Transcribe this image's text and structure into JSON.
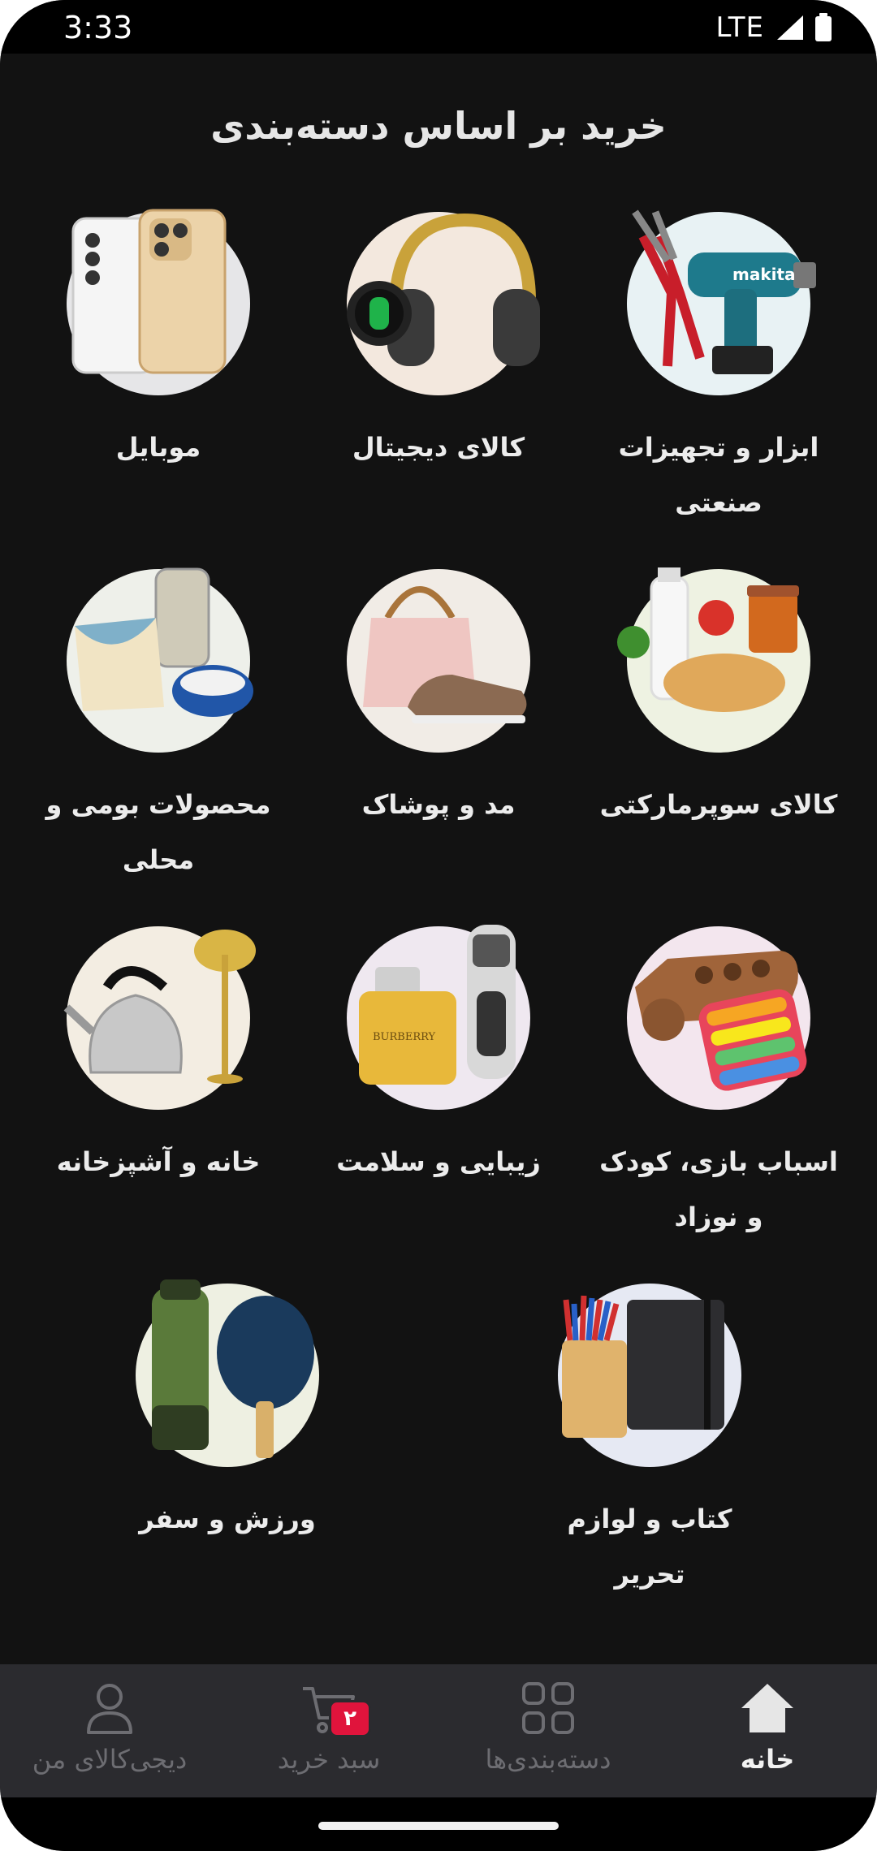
{
  "status_bar": {
    "time": "3:33",
    "network": "LTE"
  },
  "page": {
    "title": "خرید بر اساس دسته‌بندی"
  },
  "categories": [
    {
      "label": "ابزار و تجهیزات صنعتی",
      "icon": "drill-icon",
      "bg": "#e8f2f4"
    },
    {
      "label": "کالای دیجیتال",
      "icon": "headphones-icon",
      "bg": "#f3e8de"
    },
    {
      "label": "موبایل",
      "icon": "smartphone-icon",
      "bg": "#e6e6e8"
    },
    {
      "label": "کالای سوپرمارکتی",
      "icon": "groceries-icon",
      "bg": "#eef2e2"
    },
    {
      "label": "مد و پوشاک",
      "icon": "handbag-icon",
      "bg": "#f1ece6"
    },
    {
      "label": "محصولات بومی و محلی",
      "icon": "local-products-icon",
      "bg": "#eef0ea"
    },
    {
      "label": "اسباب بازی، کودک و نوزاد",
      "icon": "toy-icon",
      "bg": "#f3e6ee"
    },
    {
      "label": "زیبایی و سلامت",
      "icon": "perfume-icon",
      "bg": "#efe8f0"
    },
    {
      "label": "خانه و آشپزخانه",
      "icon": "kettle-icon",
      "bg": "#f3ede2"
    },
    {
      "label": "کتاب و لوازم تحریر",
      "icon": "notebook-icon",
      "bg": "#e6e9f3"
    },
    {
      "label": "ورزش و سفر",
      "icon": "sports-icon",
      "bg": "#eef0e2"
    }
  ],
  "bottom_nav": {
    "items": [
      {
        "label": "خانه",
        "icon": "home-icon",
        "active": true
      },
      {
        "label": "دسته‌بندی‌ها",
        "icon": "categories-icon",
        "active": false
      },
      {
        "label": "سبد خرید",
        "icon": "cart-icon",
        "active": false,
        "badge": "۲"
      },
      {
        "label": "دیجی‌کالای من",
        "icon": "profile-icon",
        "active": false
      }
    ]
  },
  "colors": {
    "background": "#121212",
    "nav_background": "#2b2b2f",
    "badge": "#e0143c"
  }
}
